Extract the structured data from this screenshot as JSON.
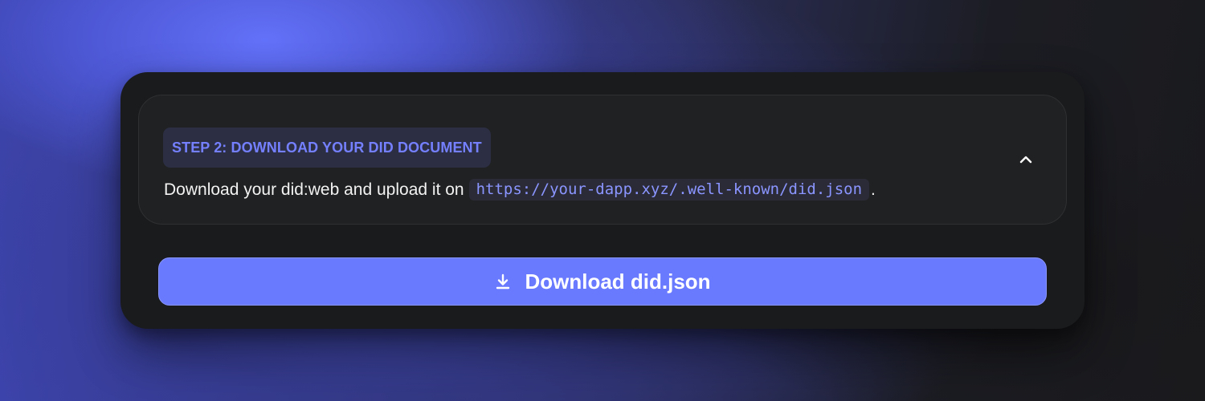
{
  "step": {
    "badge": "STEP 2: DOWNLOAD YOUR DID DOCUMENT",
    "description_prefix": "Download your did:web and upload it on",
    "url": "https://your-dapp.xyz/.well-known/did.json",
    "description_suffix": "."
  },
  "icons": {
    "toggle": "chevron-up-icon",
    "download": "download-icon"
  },
  "download_button": {
    "label": "Download did.json"
  },
  "colors": {
    "accent": "#6a7aff",
    "badge_text": "#7480ff",
    "panel_bg": "#1a1b1c",
    "card_bg": "#202122"
  }
}
